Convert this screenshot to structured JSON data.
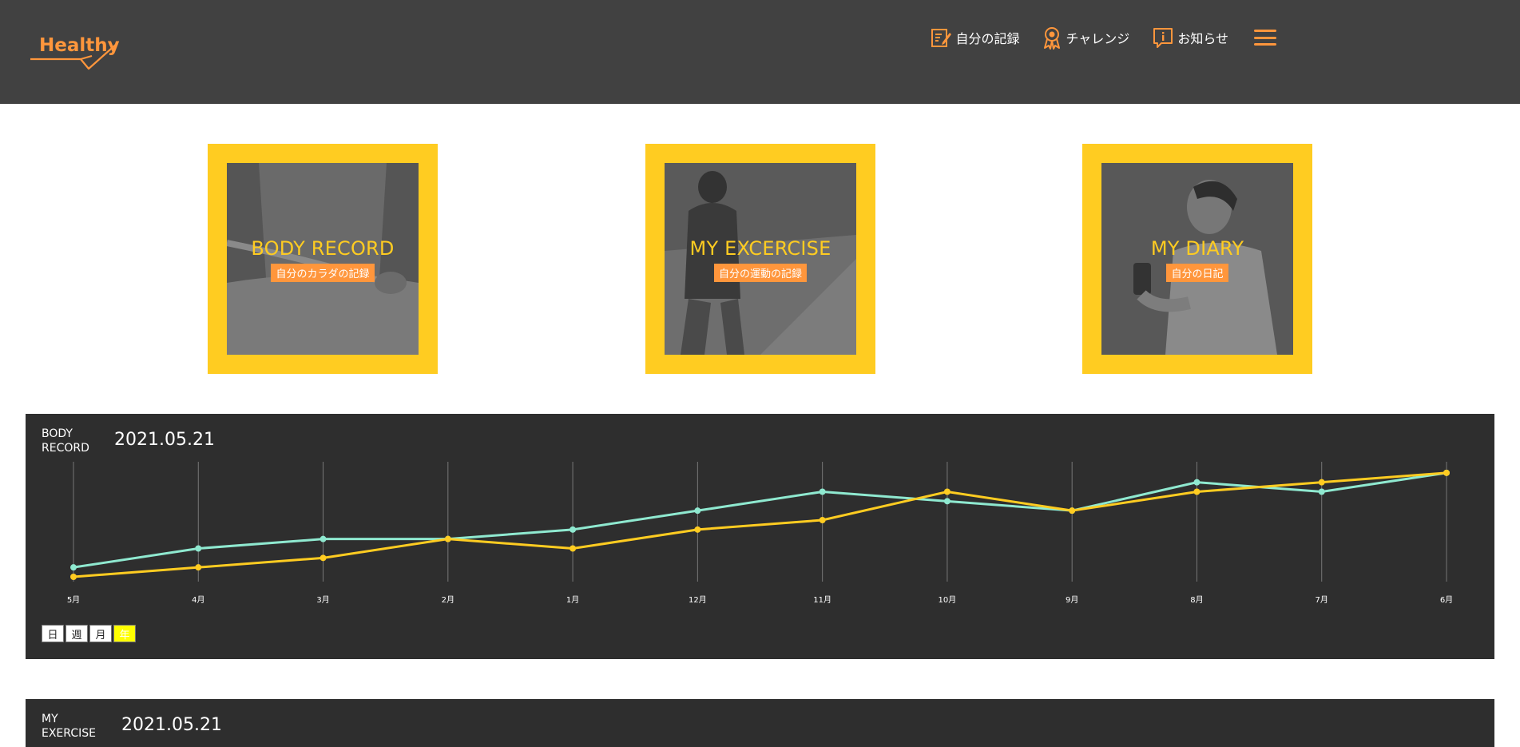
{
  "header": {
    "logo_text": "Healthy",
    "nav": [
      {
        "label": "自分の記録",
        "icon": "memo-icon"
      },
      {
        "label": "チャレンジ",
        "icon": "challenge-medal-icon"
      },
      {
        "label": "お知らせ",
        "icon": "info-icon"
      }
    ],
    "menu_icon": "hamburger-menu-icon",
    "accent_color": "#FF963C"
  },
  "cards": [
    {
      "title": "BODY RECORD",
      "subtitle": "自分のカラダの記録"
    },
    {
      "title": "MY EXCERCISE",
      "subtitle": "自分の運動の記録"
    },
    {
      "title": "MY DIARY",
      "subtitle": "自分の日記"
    }
  ],
  "body_record": {
    "label_line1": "BODY",
    "label_line2": "RECORD",
    "date": "2021.05.21",
    "range_tabs": [
      "日",
      "週",
      "月",
      "年"
    ],
    "active_tab": "年"
  },
  "my_exercise": {
    "label_line1": "MY",
    "label_line2": "EXERCISE",
    "date": "2021.05.21"
  },
  "chart_data": {
    "type": "line",
    "categories": [
      "5月",
      "4月",
      "3月",
      "2月",
      "1月",
      "12月",
      "11月",
      "10月",
      "9月",
      "8月",
      "7月",
      "6月"
    ],
    "ylim": [
      0,
      12
    ],
    "grid": "vertical",
    "series": [
      {
        "color": "#8FE9D0",
        "values": [
          1,
          3,
          4,
          4,
          5,
          7,
          9,
          8,
          7,
          10,
          9,
          11
        ]
      },
      {
        "color": "#FFCC21",
        "values": [
          0,
          1,
          2,
          4,
          3,
          5,
          6,
          9,
          7,
          9,
          10,
          11
        ]
      }
    ]
  }
}
